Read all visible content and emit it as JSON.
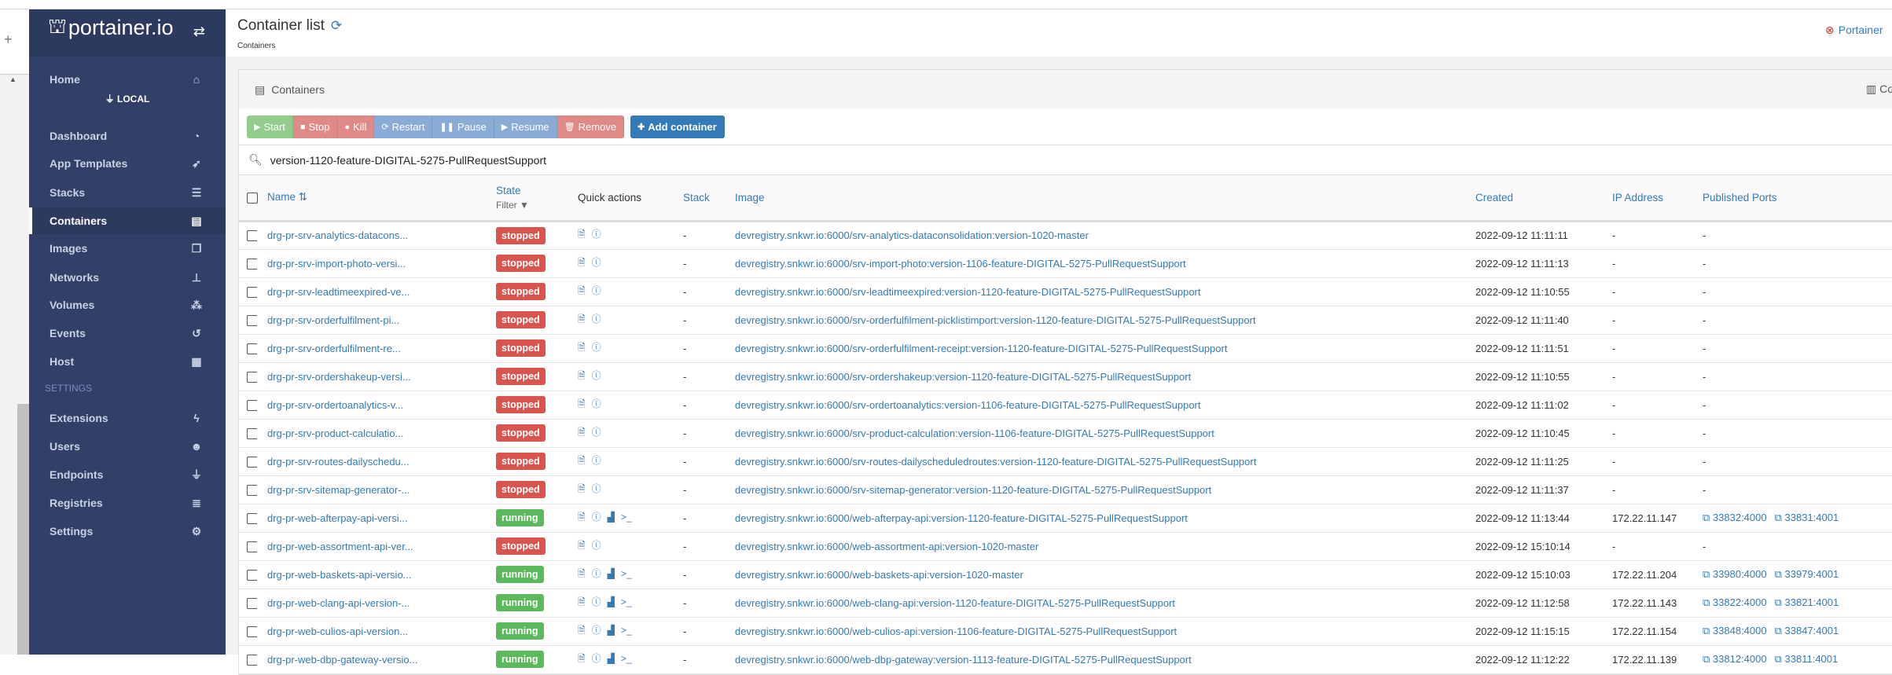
{
  "sidebar": {
    "brand": "portainer.io",
    "endpoint": "LOCAL",
    "settings_section": "SETTINGS",
    "items": [
      {
        "label": "Home",
        "icon": "home-icon",
        "glyph": "⌂"
      },
      {
        "label": "Dashboard",
        "icon": "dashboard-icon",
        "glyph": "◔"
      },
      {
        "label": "App Templates",
        "icon": "rocket-icon",
        "glyph": "➶"
      },
      {
        "label": "Stacks",
        "icon": "th-list-icon",
        "glyph": "☰"
      },
      {
        "label": "Containers",
        "icon": "server-icon",
        "glyph": "▤",
        "active": true
      },
      {
        "label": "Images",
        "icon": "clone-icon",
        "glyph": "❐"
      },
      {
        "label": "Networks",
        "icon": "sitemap-icon",
        "glyph": "⊥"
      },
      {
        "label": "Volumes",
        "icon": "cubes-icon",
        "glyph": "⁂"
      },
      {
        "label": "Events",
        "icon": "history-icon",
        "glyph": "↺"
      },
      {
        "label": "Host",
        "icon": "th-icon",
        "glyph": "▦"
      }
    ],
    "settings_items": [
      {
        "label": "Extensions",
        "icon": "bolt-icon",
        "glyph": "ϟ"
      },
      {
        "label": "Users",
        "icon": "users-icon",
        "glyph": "☻"
      },
      {
        "label": "Endpoints",
        "icon": "plug-icon",
        "glyph": "⏚"
      },
      {
        "label": "Registries",
        "icon": "database-icon",
        "glyph": "≣"
      },
      {
        "label": "Settings",
        "icon": "cogs-icon",
        "glyph": "⚙"
      }
    ]
  },
  "header": {
    "title": "Container list",
    "breadcrumb": "Containers",
    "support_link": "Portainer"
  },
  "widget": {
    "title": "Containers",
    "columns_label": "Co",
    "buttons": {
      "start": "Start",
      "stop": "Stop",
      "kill": "Kill",
      "restart": "Restart",
      "pause": "Pause",
      "resume": "Resume",
      "remove": "Remove",
      "add": "Add container"
    },
    "search_value": "version-1120-feature-DIGITAL-5275-PullRequestSupport",
    "columns": {
      "name": "Name",
      "state": "State",
      "state_filter": "Filter",
      "quick_actions": "Quick actions",
      "stack": "Stack",
      "image": "Image",
      "created": "Created",
      "ip": "IP Address",
      "ports": "Published Ports"
    }
  },
  "colors": {
    "stopped": "#d9534f",
    "running": "#5cb85c",
    "link": "#337ab7",
    "sidebar": "#323f67"
  },
  "rows": [
    {
      "name": "drg-pr-srv-analytics-datacons...",
      "state": "stopped",
      "stack": "-",
      "image": "devregistry.snkwr.io:6000/srv-analytics-dataconsolidation:version-1020-master",
      "created": "2022-09-12 11:11:11",
      "ip": "-",
      "ports": []
    },
    {
      "name": "drg-pr-srv-import-photo-versi...",
      "state": "stopped",
      "stack": "-",
      "image": "devregistry.snkwr.io:6000/srv-import-photo:version-1106-feature-DIGITAL-5275-PullRequestSupport",
      "created": "2022-09-12 11:11:13",
      "ip": "-",
      "ports": []
    },
    {
      "name": "drg-pr-srv-leadtimeexpired-ve...",
      "state": "stopped",
      "stack": "-",
      "image": "devregistry.snkwr.io:6000/srv-leadtimeexpired:version-1120-feature-DIGITAL-5275-PullRequestSupport",
      "created": "2022-09-12 11:10:55",
      "ip": "-",
      "ports": []
    },
    {
      "name": "drg-pr-srv-orderfulfilment-pi...",
      "state": "stopped",
      "stack": "-",
      "image": "devregistry.snkwr.io:6000/srv-orderfulfilment-picklistimport:version-1120-feature-DIGITAL-5275-PullRequestSupport",
      "created": "2022-09-12 11:11:40",
      "ip": "-",
      "ports": []
    },
    {
      "name": "drg-pr-srv-orderfulfilment-re...",
      "state": "stopped",
      "stack": "-",
      "image": "devregistry.snkwr.io:6000/srv-orderfulfilment-receipt:version-1120-feature-DIGITAL-5275-PullRequestSupport",
      "created": "2022-09-12 11:11:51",
      "ip": "-",
      "ports": []
    },
    {
      "name": "drg-pr-srv-ordershakeup-versi...",
      "state": "stopped",
      "stack": "-",
      "image": "devregistry.snkwr.io:6000/srv-ordershakeup:version-1120-feature-DIGITAL-5275-PullRequestSupport",
      "created": "2022-09-12 11:10:55",
      "ip": "-",
      "ports": []
    },
    {
      "name": "drg-pr-srv-ordertoanalytics-v...",
      "state": "stopped",
      "stack": "-",
      "image": "devregistry.snkwr.io:6000/srv-ordertoanalytics:version-1106-feature-DIGITAL-5275-PullRequestSupport",
      "created": "2022-09-12 11:11:02",
      "ip": "-",
      "ports": []
    },
    {
      "name": "drg-pr-srv-product-calculatio...",
      "state": "stopped",
      "stack": "-",
      "image": "devregistry.snkwr.io:6000/srv-product-calculation:version-1106-feature-DIGITAL-5275-PullRequestSupport",
      "created": "2022-09-12 11:10:45",
      "ip": "-",
      "ports": []
    },
    {
      "name": "drg-pr-srv-routes-dailyschedu...",
      "state": "stopped",
      "stack": "-",
      "image": "devregistry.snkwr.io:6000/srv-routes-dailyscheduledroutes:version-1120-feature-DIGITAL-5275-PullRequestSupport",
      "created": "2022-09-12 11:11:25",
      "ip": "-",
      "ports": []
    },
    {
      "name": "drg-pr-srv-sitemap-generator-...",
      "state": "stopped",
      "stack": "-",
      "image": "devregistry.snkwr.io:6000/srv-sitemap-generator:version-1120-feature-DIGITAL-5275-PullRequestSupport",
      "created": "2022-09-12 11:11:37",
      "ip": "-",
      "ports": []
    },
    {
      "name": "drg-pr-web-afterpay-api-versi...",
      "state": "running",
      "stack": "-",
      "image": "devregistry.snkwr.io:6000/web-afterpay-api:version-1120-feature-DIGITAL-5275-PullRequestSupport",
      "created": "2022-09-12 11:13:44",
      "ip": "172.22.11.147",
      "ports": [
        "33832:4000",
        "33831:4001"
      ]
    },
    {
      "name": "drg-pr-web-assortment-api-ver...",
      "state": "stopped",
      "stack": "-",
      "image": "devregistry.snkwr.io:6000/web-assortment-api:version-1020-master",
      "created": "2022-09-12 15:10:14",
      "ip": "-",
      "ports": []
    },
    {
      "name": "drg-pr-web-baskets-api-versio...",
      "state": "running",
      "stack": "-",
      "image": "devregistry.snkwr.io:6000/web-baskets-api:version-1020-master",
      "created": "2022-09-12 15:10:03",
      "ip": "172.22.11.204",
      "ports": [
        "33980:4000",
        "33979:4001"
      ]
    },
    {
      "name": "drg-pr-web-clang-api-version-...",
      "state": "running",
      "stack": "-",
      "image": "devregistry.snkwr.io:6000/web-clang-api:version-1120-feature-DIGITAL-5275-PullRequestSupport",
      "created": "2022-09-12 11:12:58",
      "ip": "172.22.11.143",
      "ports": [
        "33822:4000",
        "33821:4001"
      ]
    },
    {
      "name": "drg-pr-web-culios-api-version...",
      "state": "running",
      "stack": "-",
      "image": "devregistry.snkwr.io:6000/web-culios-api:version-1106-feature-DIGITAL-5275-PullRequestSupport",
      "created": "2022-09-12 11:15:15",
      "ip": "172.22.11.154",
      "ports": [
        "33848:4000",
        "33847:4001"
      ]
    },
    {
      "name": "drg-pr-web-dbp-gateway-versio...",
      "state": "running",
      "stack": "-",
      "image": "devregistry.snkwr.io:6000/web-dbp-gateway:version-1113-feature-DIGITAL-5275-PullRequestSupport",
      "created": "2022-09-12 11:12:22",
      "ip": "172.22.11.139",
      "ports": [
        "33812:4000",
        "33811:4001"
      ]
    }
  ]
}
